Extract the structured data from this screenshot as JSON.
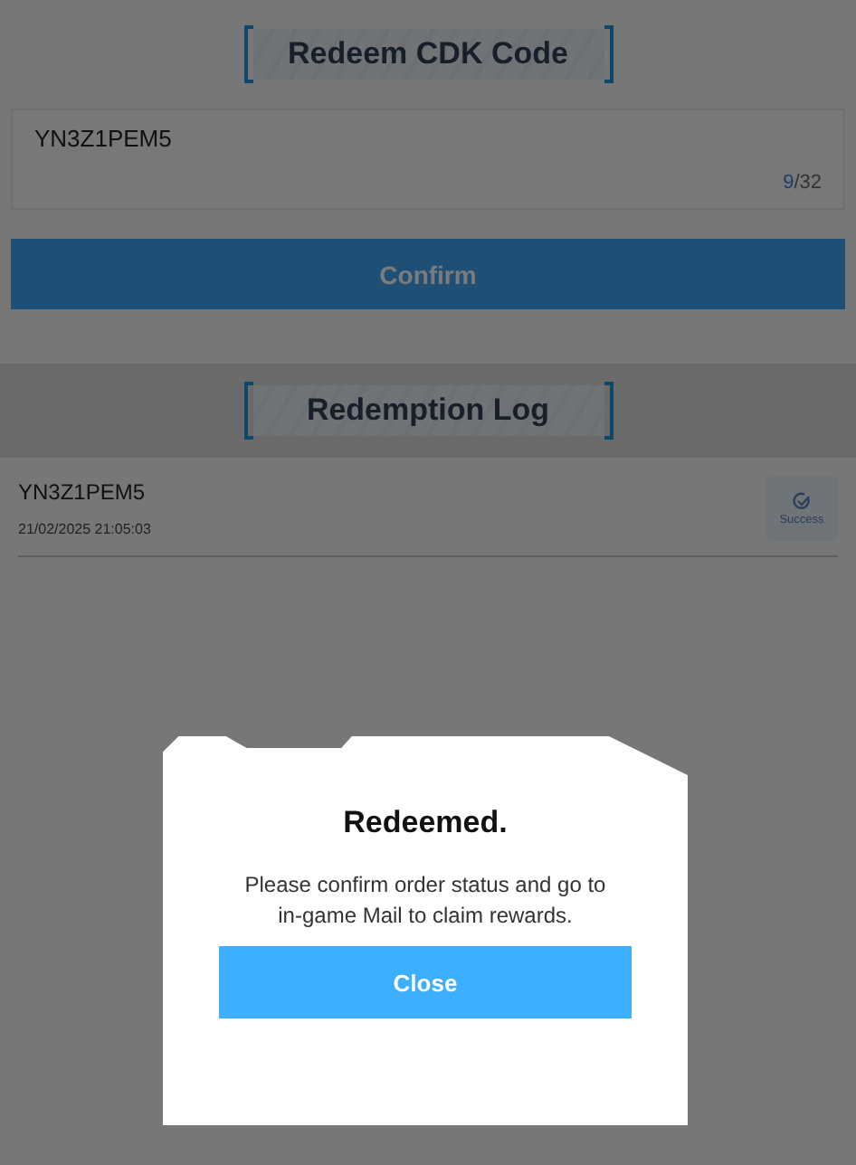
{
  "redeem": {
    "title": "Redeem CDK Code",
    "input": {
      "value": "YN3Z1PEM5",
      "counter_current": "9",
      "counter_limit": "/32"
    },
    "confirm_button": "Confirm"
  },
  "log": {
    "title": "Redemption Log",
    "entries": [
      {
        "code": "YN3Z1PEM5",
        "time": "21/02/2025 21:05:03",
        "status": "Success"
      }
    ]
  },
  "dialog": {
    "title": "Redeemed.",
    "message": "Please confirm order status and go to in-game Mail to claim rewards.",
    "button": "Close"
  }
}
